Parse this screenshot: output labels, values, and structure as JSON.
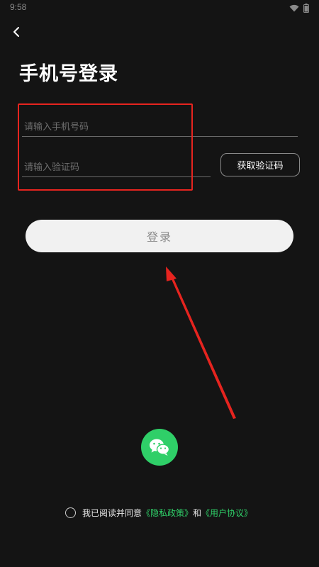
{
  "status_bar": {
    "time": "9:58",
    "icons": [
      "wifi-icon",
      "battery-icon"
    ]
  },
  "nav": {
    "back_icon": "chevron-left-icon"
  },
  "page": {
    "title": "手机号登录"
  },
  "form": {
    "phone_placeholder": "请输入手机号码",
    "phone_value": "",
    "code_placeholder": "请输入验证码",
    "code_value": "",
    "get_code_label": "获取验证码",
    "login_label": "登录"
  },
  "social": {
    "wechat_icon": "wechat-icon"
  },
  "agreement": {
    "prefix": "我已阅读并同意",
    "privacy_link": "《隐私政策》",
    "connector": "和",
    "terms_link": "《用户协议》",
    "checked": false
  },
  "colors": {
    "background": "#141414",
    "accent_green": "#2fcf68",
    "annotation_red": "#e6241f",
    "login_button_bg": "#f1f1f1"
  }
}
